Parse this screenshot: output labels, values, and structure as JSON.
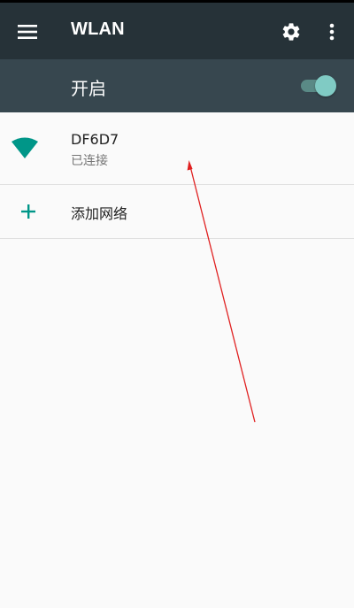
{
  "app_bar": {
    "title": "WLAN",
    "menu_icon": "menu-icon",
    "settings_icon": "gear-icon",
    "more_icon": "more-vert-icon",
    "background_color": "#263238"
  },
  "master_switch": {
    "label": "开启",
    "state": "on",
    "background_color": "#37474f",
    "accent_color": "#80cbc4"
  },
  "networks": [
    {
      "ssid": "DF6D7",
      "status": "已连接",
      "icon": "wifi-signal-icon",
      "icon_color": "#009688"
    }
  ],
  "add_network": {
    "label": "添加网络",
    "icon": "plus-icon",
    "icon_color": "#009688"
  },
  "annotation": {
    "type": "arrow",
    "color": "#e02020"
  }
}
